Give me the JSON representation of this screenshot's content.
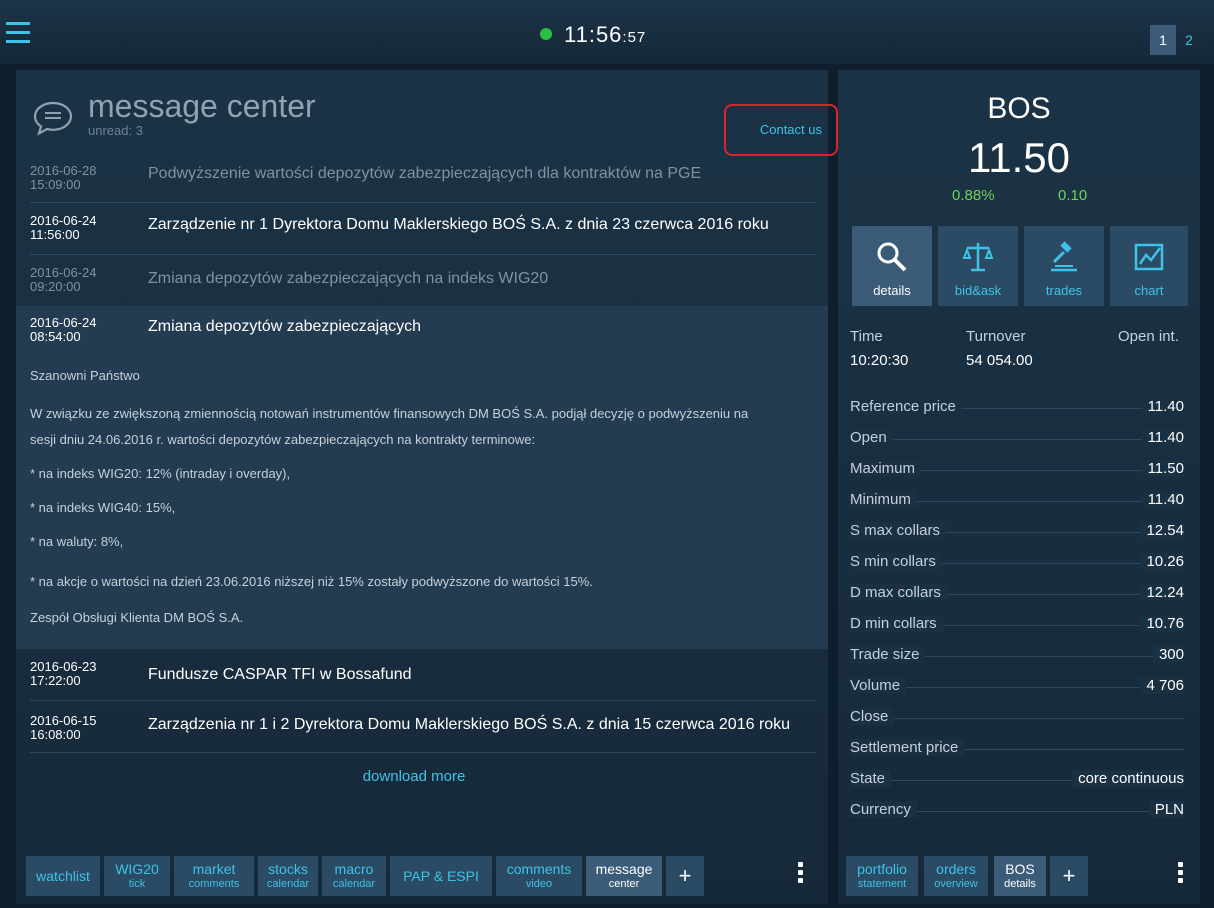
{
  "topbar": {
    "clock_main": "11:56",
    "clock_sec": ":57",
    "pages": [
      "1",
      "2"
    ]
  },
  "message_center": {
    "title": "message center",
    "unread_label": "unread: 3",
    "contact_label": "Contact us",
    "messages": [
      {
        "date": "2016-06-28",
        "time": "15:09:00",
        "subject": "Podwyższenie wartości depozytów zabezpieczających dla kontraktów na PGE",
        "status": "read"
      },
      {
        "date": "2016-06-24",
        "time": "11:56:00",
        "subject": "Zarządzenie nr 1 Dyrektora Domu Maklerskiego BOŚ S.A. z dnia 23 czerwca 2016 roku",
        "status": "unread"
      },
      {
        "date": "2016-06-24",
        "time": "09:20:00",
        "subject": "Zmiana depozytów zabezpieczających na indeks WIG20",
        "status": "read"
      },
      {
        "date": "2016-06-24",
        "time": "08:54:00",
        "subject": "Zmiana depozytów zabezpieczających",
        "status": "expanded"
      },
      {
        "date": "2016-06-23",
        "time": "17:22:00",
        "subject": "Fundusze CASPAR TFI w Bossafund",
        "status": "unread"
      },
      {
        "date": "2016-06-15",
        "time": "16:08:00",
        "subject": "Zarządzenia nr 1 i 2 Dyrektora Domu Maklerskiego BOŚ S.A. z dnia 15 czerwca 2016 roku",
        "status": "unread"
      }
    ],
    "expanded_body": [
      "Szanowni Państwo",
      "W związku ze zwiększoną zmiennością notowań instrumentów finansowych DM BOŚ S.A. podjął decyzję o podwyższeniu na",
      "sesji dniu 24.06.2016 r. wartości depozytów zabezpieczających na kontrakty terminowe:",
      "* na indeks WIG20: 12% (intraday i overday),",
      "* na indeks WIG40: 15%,",
      "* na waluty: 8%,",
      "* na akcje o wartości na dzień 23.06.2016 niższej niż 15% zostały podwyższone do wartości 15%.",
      "Zespół Obsługi Klienta DM BOŚ S.A."
    ],
    "download_more": "download more"
  },
  "left_tabs": [
    {
      "l1": "watchlist",
      "l2": ""
    },
    {
      "l1": "WIG20",
      "l2": "tick"
    },
    {
      "l1": "market",
      "l2": "comments"
    },
    {
      "l1": "stocks",
      "l2": "calendar"
    },
    {
      "l1": "macro",
      "l2": "calendar"
    },
    {
      "l1": "PAP & ESPI",
      "l2": ""
    },
    {
      "l1": "comments",
      "l2": "video"
    },
    {
      "l1": "message",
      "l2": "center"
    },
    {
      "l1": "+",
      "l2": ""
    }
  ],
  "instrument": {
    "symbol": "BOS",
    "price": "11.50",
    "change_pct": "0.88%",
    "change_val": "0.10",
    "view_tabs": [
      "details",
      "bid&ask",
      "trades",
      "chart"
    ],
    "headers": {
      "time": "Time",
      "turnover": "Turnover",
      "open_int": "Open int."
    },
    "header_values": {
      "time": "10:20:30",
      "turnover": "54 054.00",
      "open_int": ""
    },
    "details": [
      {
        "label": "Reference price",
        "value": "11.40"
      },
      {
        "label": "Open",
        "value": "11.40"
      },
      {
        "label": "Maximum",
        "value": "11.50"
      },
      {
        "label": "Minimum",
        "value": "11.40"
      },
      {
        "label": "S max collars",
        "value": "12.54"
      },
      {
        "label": "S min collars",
        "value": "10.26"
      },
      {
        "label": "D max collars",
        "value": "12.24"
      },
      {
        "label": "D min collars",
        "value": "10.76"
      },
      {
        "label": "Trade size",
        "value": "300"
      },
      {
        "label": "Volume",
        "value": "4 706"
      },
      {
        "label": "Close",
        "value": ""
      },
      {
        "label": "Settlement price",
        "value": ""
      },
      {
        "label": "State",
        "value": "core continuous"
      },
      {
        "label": "Currency",
        "value": "PLN"
      }
    ]
  },
  "right_tabs": [
    {
      "l1": "portfolio",
      "l2": "statement"
    },
    {
      "l1": "orders",
      "l2": "overview"
    },
    {
      "l1": "BOS",
      "l2": "details"
    },
    {
      "l1": "+",
      "l2": ""
    }
  ],
  "colors": {
    "accent": "#3ec3e8",
    "positive": "#6fd15a",
    "live_dot": "#29c043",
    "highlight": "#d9232e"
  }
}
